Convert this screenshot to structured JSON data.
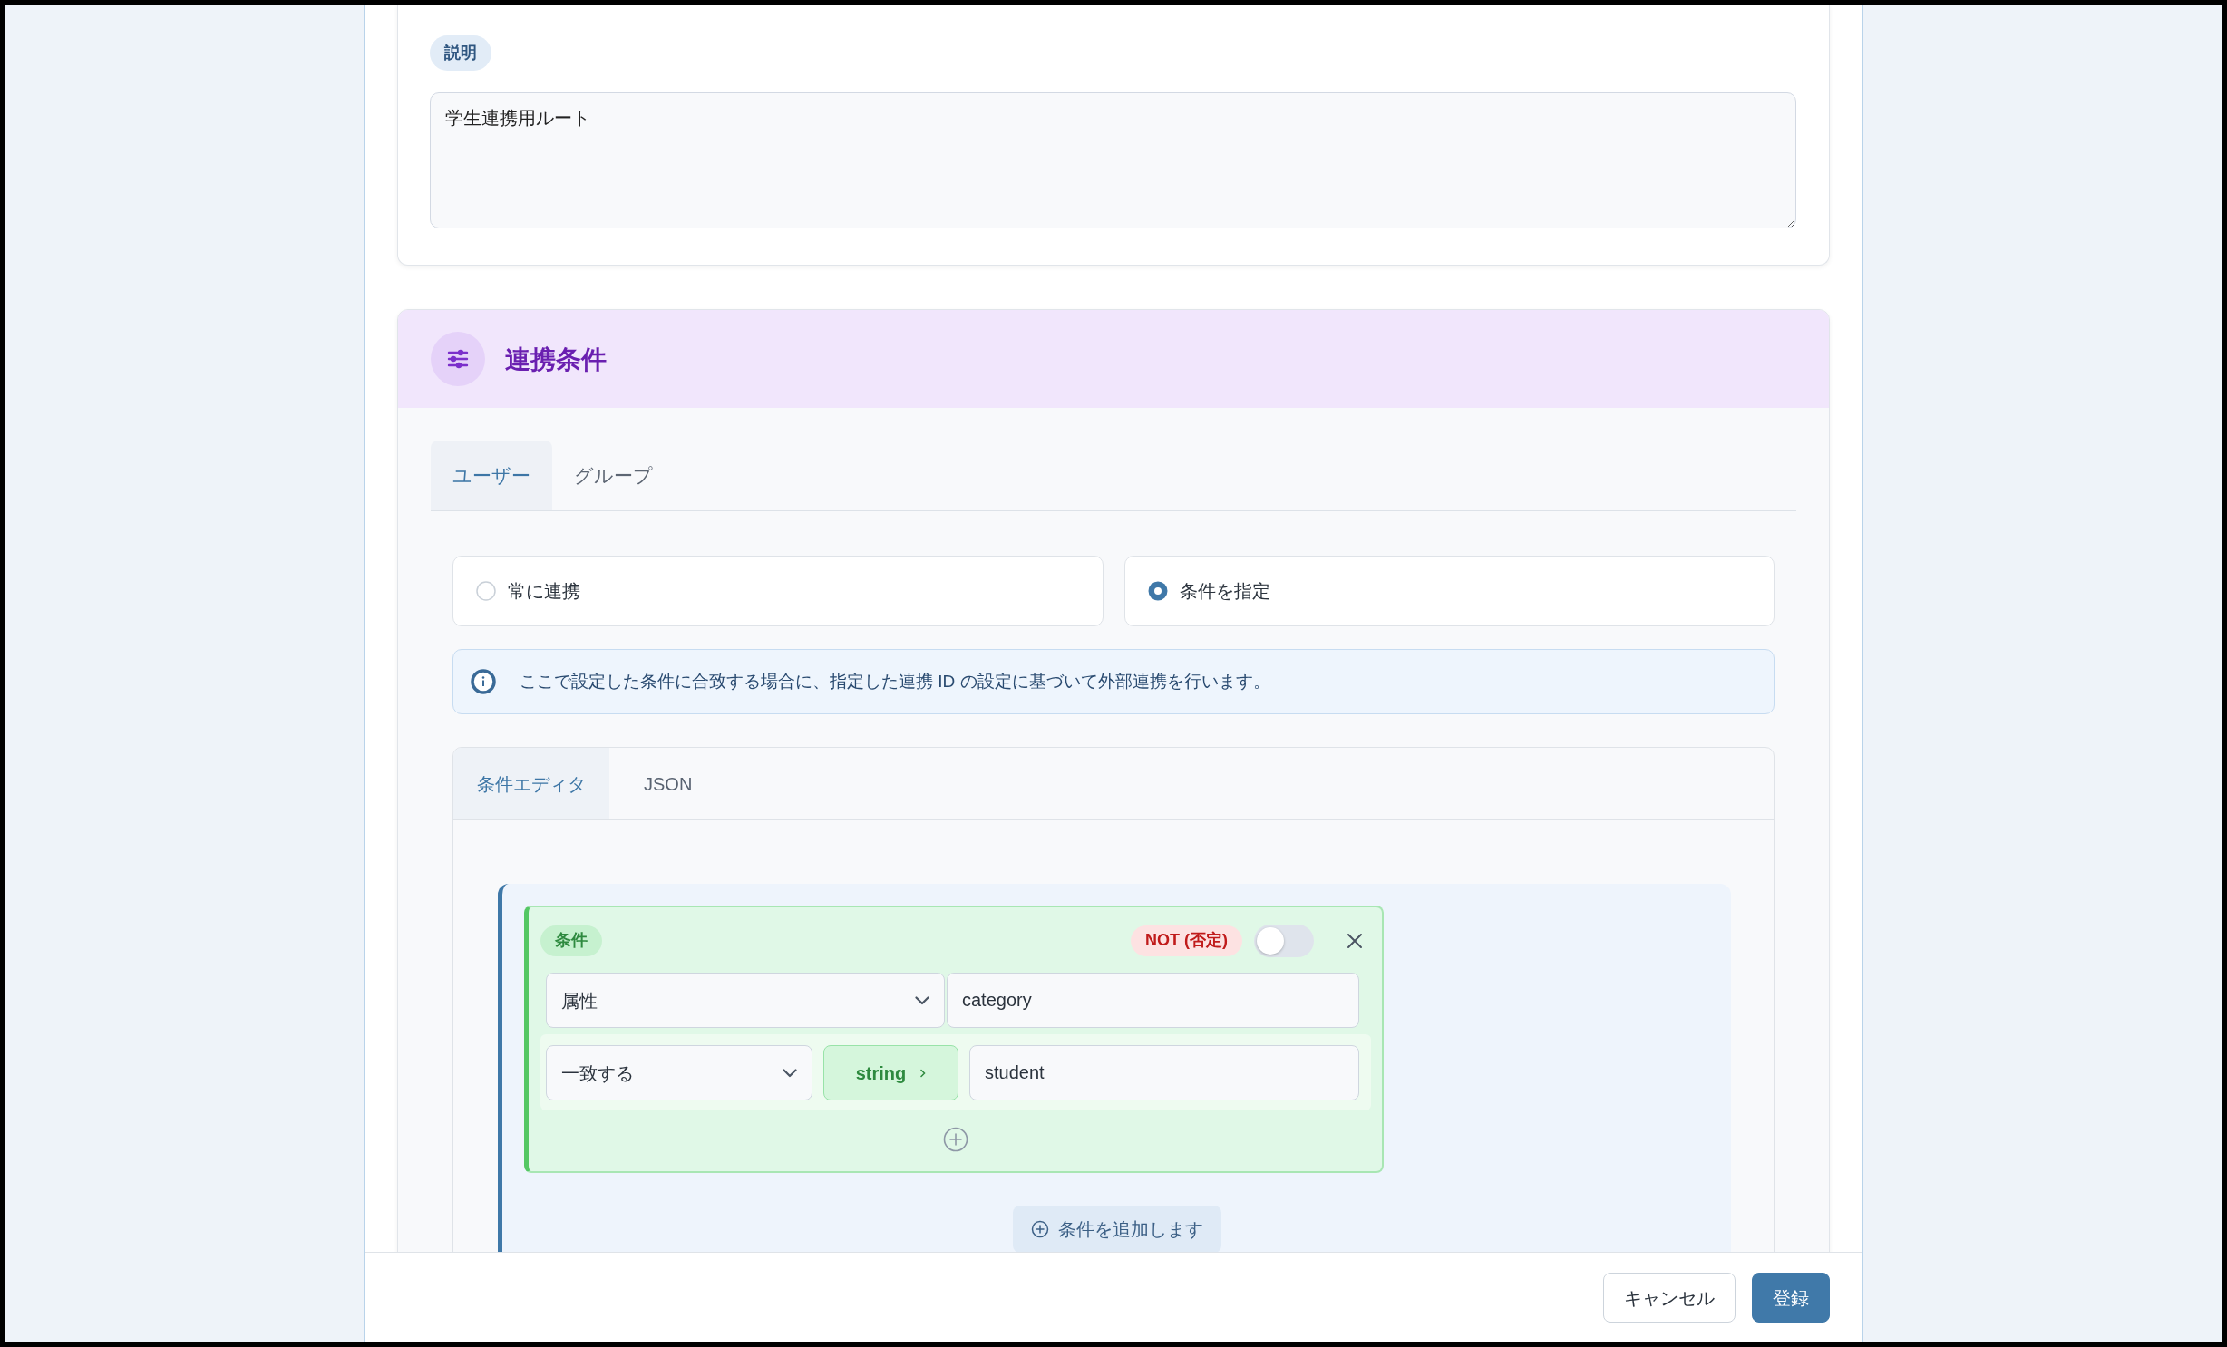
{
  "description": {
    "label": "説明",
    "value": "学生連携用ルート"
  },
  "linkage_conditions": {
    "title": "連携条件",
    "tabs": [
      {
        "label": "ユーザー",
        "selected": true
      },
      {
        "label": "グループ",
        "selected": false
      }
    ],
    "mode_options": [
      {
        "label": "常に連携",
        "selected": false
      },
      {
        "label": "条件を指定",
        "selected": true
      }
    ],
    "info_message": "ここで設定した条件に合致する場合に、指定した連携 ID の設定に基づいて外部連携を行います。",
    "editor_tabs": [
      {
        "label": "条件エディタ",
        "selected": true
      },
      {
        "label": "JSON",
        "selected": false
      }
    ],
    "condition_group": {
      "conditions": [
        {
          "badge": "条件",
          "not_label": "NOT (否定)",
          "negated": false,
          "source": "属性",
          "attribute": "category",
          "operator": "一致する",
          "value_type": "string",
          "value": "student"
        }
      ],
      "add_button": "条件を追加します"
    }
  },
  "footer_buttons": [
    {
      "label": "キャンセル",
      "kind": "secondary"
    },
    {
      "label": "登録",
      "kind": "primary"
    }
  ]
}
